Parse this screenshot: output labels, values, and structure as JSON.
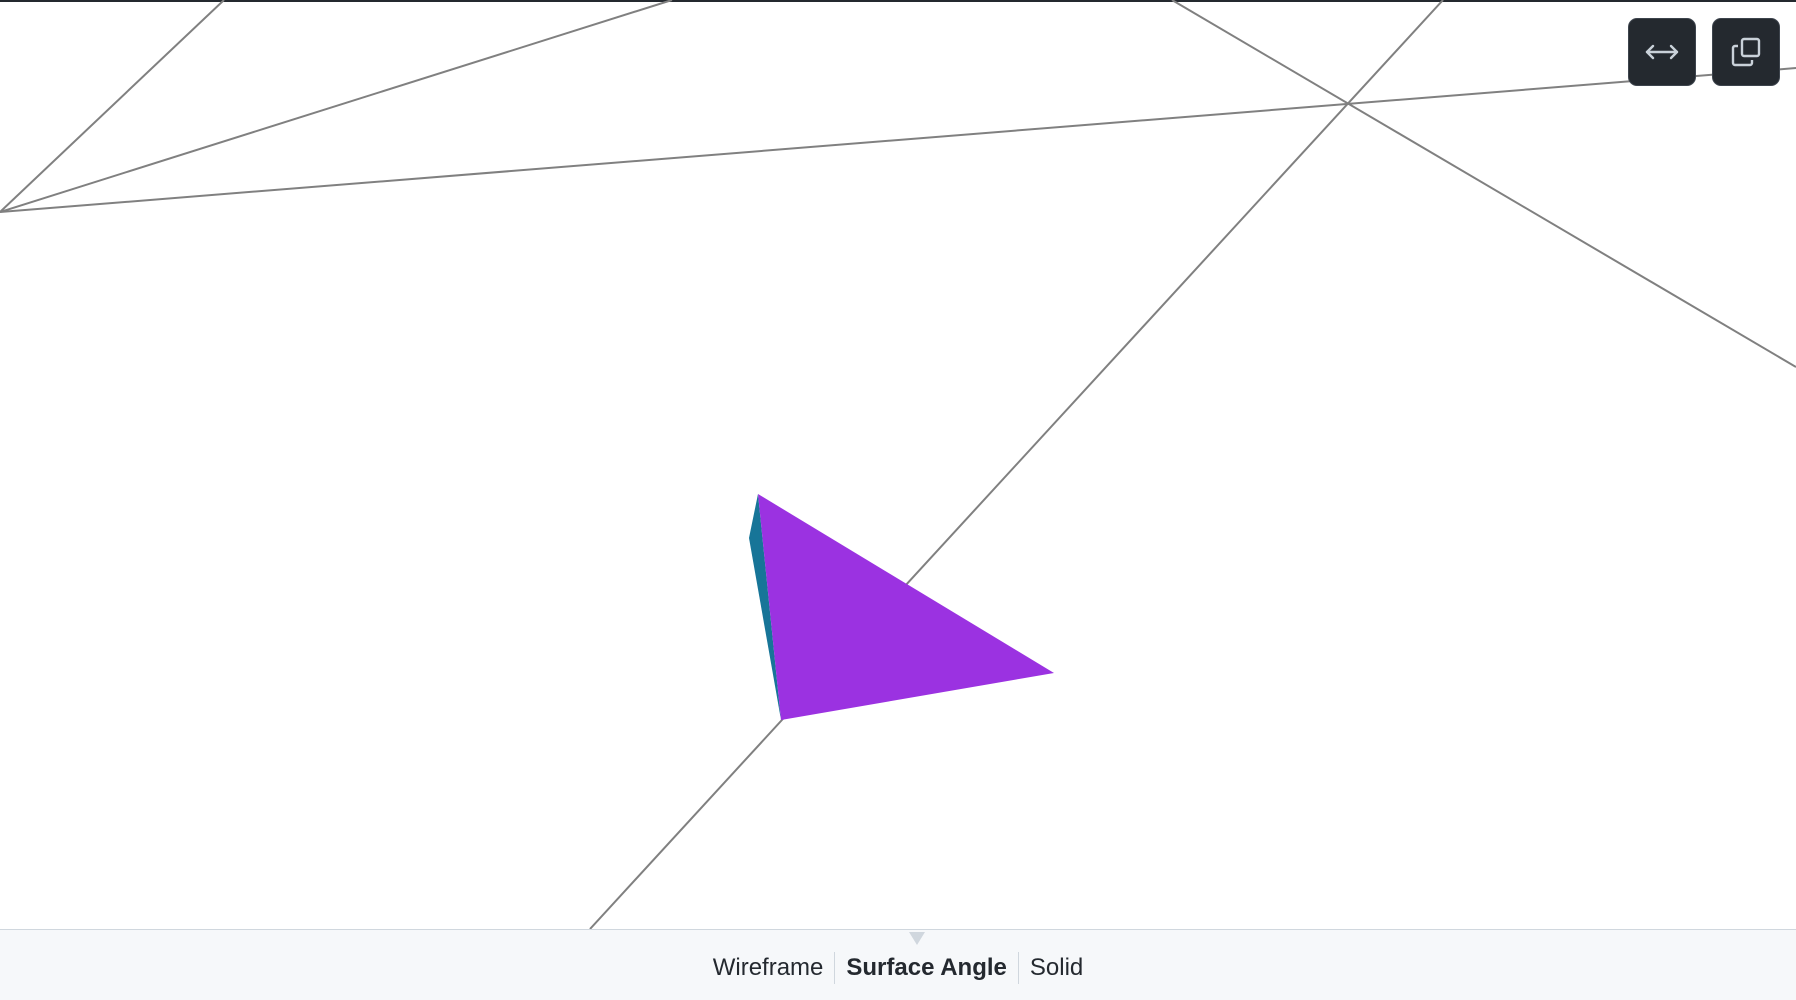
{
  "viewer": {
    "mode_tabs": [
      "Wireframe",
      "Surface Angle",
      "Solid"
    ],
    "active_mode": "Surface Angle",
    "colors": {
      "face_main": "#9b32e1",
      "face_side": "#177598",
      "wire": "#808080",
      "button_bg": "#24292f",
      "bar_bg": "#f6f8fa"
    }
  },
  "toolbar": {
    "expand_icon": "arrows-horizontal-icon",
    "copy_icon": "copy-icon"
  }
}
